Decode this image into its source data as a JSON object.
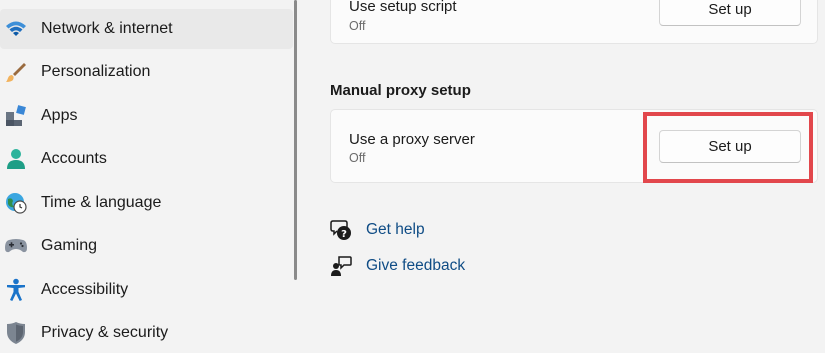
{
  "sidebar": {
    "items": [
      {
        "label": "Network & internet",
        "icon": "wifi-icon",
        "selected": true
      },
      {
        "label": "Personalization",
        "icon": "brush-icon"
      },
      {
        "label": "Apps",
        "icon": "apps-icon"
      },
      {
        "label": "Accounts",
        "icon": "person-icon"
      },
      {
        "label": "Time & language",
        "icon": "globe-clock-icon"
      },
      {
        "label": "Gaming",
        "icon": "gamepad-icon"
      },
      {
        "label": "Accessibility",
        "icon": "accessibility-icon"
      },
      {
        "label": "Privacy & security",
        "icon": "shield-icon"
      }
    ]
  },
  "main": {
    "setup_script": {
      "title": "Use setup script",
      "status": "Off",
      "button": "Set up"
    },
    "manual_section_title": "Manual proxy setup",
    "proxy_server": {
      "title": "Use a proxy server",
      "status": "Off",
      "button": "Set up"
    },
    "links": [
      {
        "label": "Get help",
        "icon": "help-chat-icon"
      },
      {
        "label": "Give feedback",
        "icon": "feedback-icon"
      }
    ],
    "highlight_color": "#e2474c"
  }
}
